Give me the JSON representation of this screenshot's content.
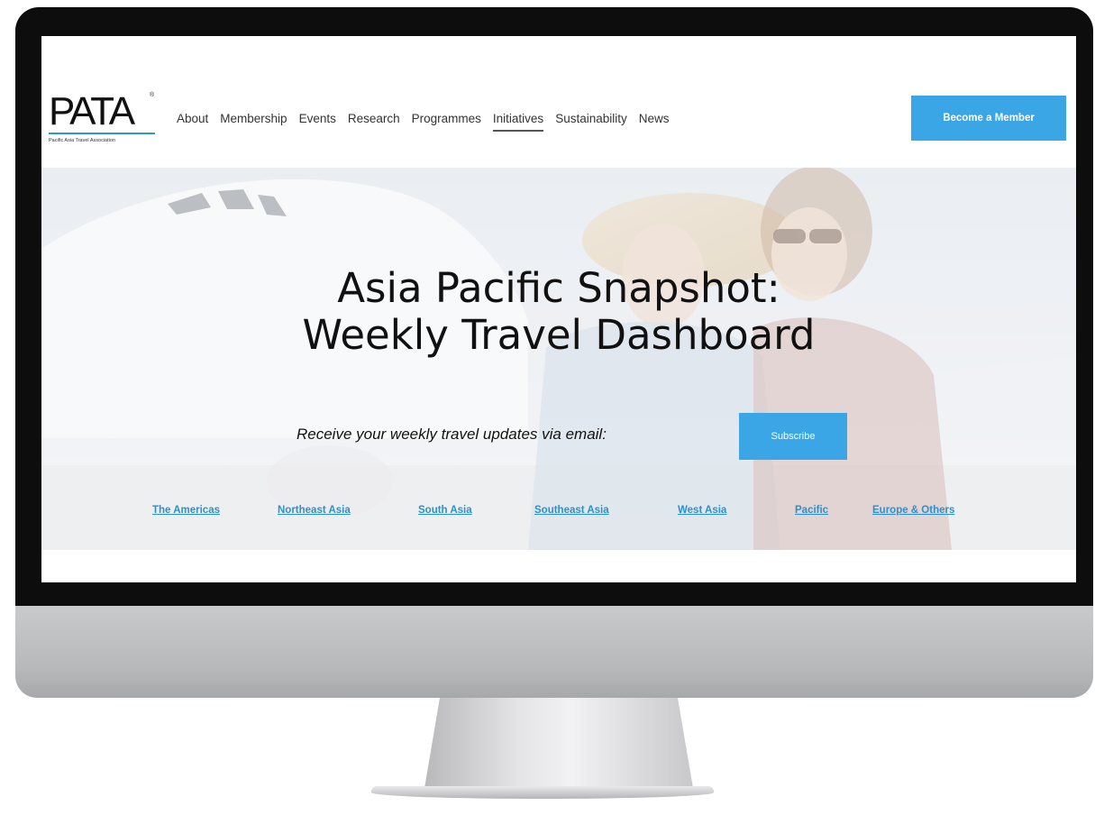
{
  "brand": {
    "logo_text": "PATA",
    "logo_mark": "®",
    "tagline": "Pacific Asia Travel Association"
  },
  "nav": {
    "items": [
      {
        "label": "About"
      },
      {
        "label": "Membership"
      },
      {
        "label": "Events"
      },
      {
        "label": "Research"
      },
      {
        "label": "Programmes"
      },
      {
        "label": "Initiatives",
        "active": true
      },
      {
        "label": "Sustainability"
      },
      {
        "label": "News"
      }
    ],
    "cta_label": "Become a Member"
  },
  "hero": {
    "title_line1": "Asia Pacific Snapshot:",
    "title_line2": "Weekly Travel Dashboard",
    "subscribe_text": "Receive your weekly travel updates via email:",
    "subscribe_button": "Subscribe"
  },
  "regions": [
    "The Americas",
    "Northeast Asia",
    "South Asia",
    "Southeast Asia",
    "West Asia",
    "Pacific",
    "Europe & Others"
  ],
  "colors": {
    "accent": "#3aa6e6",
    "link": "#2a90d4",
    "text": "#111111"
  }
}
